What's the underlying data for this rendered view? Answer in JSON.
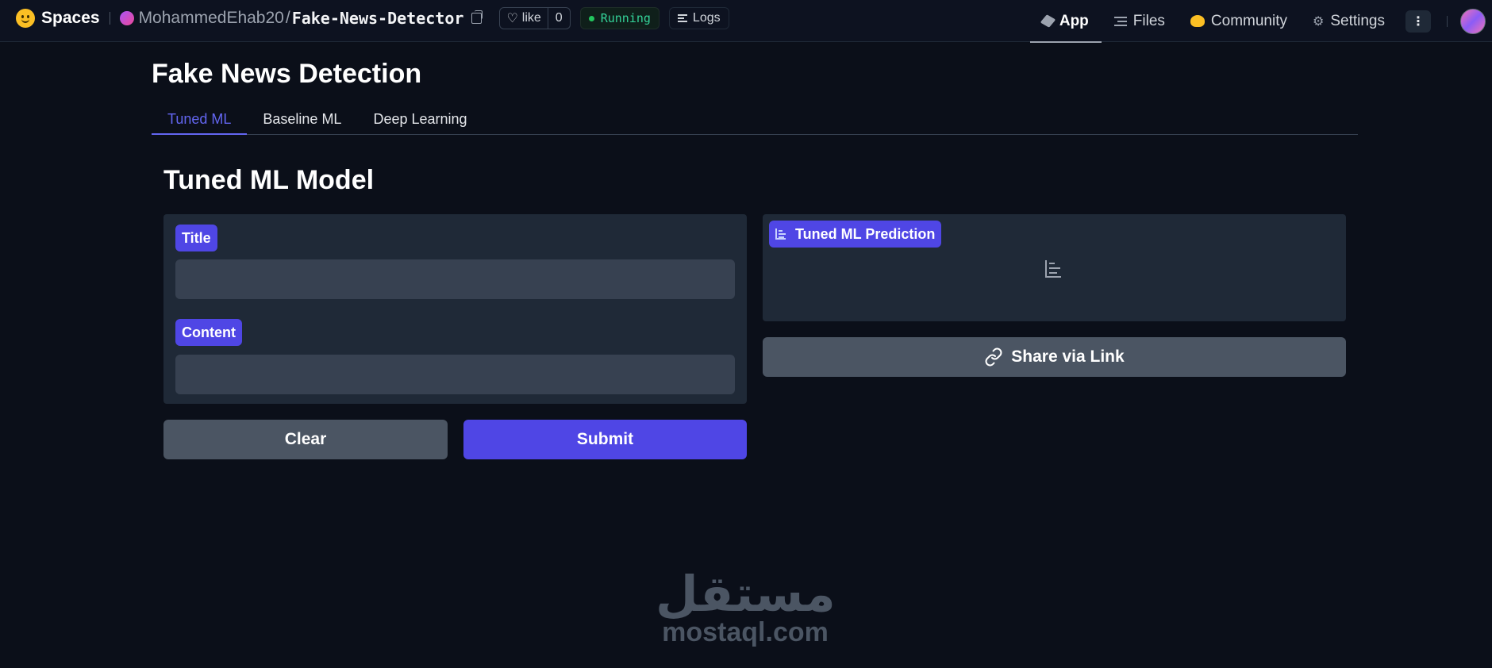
{
  "topbar": {
    "brand": "Spaces",
    "owner": "MohammedEhab20",
    "separator": "/",
    "repo": "Fake-News-Detector",
    "like_label": "like",
    "like_count": "0",
    "status": "Running",
    "logs_label": "Logs",
    "nav": [
      {
        "label": "App",
        "icon": "cube-icon",
        "active": true
      },
      {
        "label": "Files",
        "icon": "files-icon",
        "active": false
      },
      {
        "label": "Community",
        "icon": "community-icon",
        "active": false
      },
      {
        "label": "Settings",
        "icon": "gear-icon",
        "active": false
      }
    ],
    "more_glyph": "⋮"
  },
  "main": {
    "title": "Fake News Detection",
    "tabs": [
      {
        "label": "Tuned ML",
        "active": true
      },
      {
        "label": "Baseline ML",
        "active": false
      },
      {
        "label": "Deep Learning",
        "active": false
      }
    ],
    "section_title": "Tuned ML Model",
    "inputs": {
      "title_label": "Title",
      "title_value": "",
      "content_label": "Content",
      "content_value": ""
    },
    "buttons": {
      "clear": "Clear",
      "submit": "Submit",
      "share": "Share via Link"
    },
    "output": {
      "label": "Tuned ML Prediction"
    }
  },
  "watermark": {
    "arabic": "مستقل",
    "latin": "mostaql.com"
  },
  "colors": {
    "background": "#0b0f19",
    "accent": "#4f46e5",
    "panel": "#1f2937",
    "input": "#374151",
    "secondary_button": "#4b5563",
    "status_green": "#34d399"
  }
}
